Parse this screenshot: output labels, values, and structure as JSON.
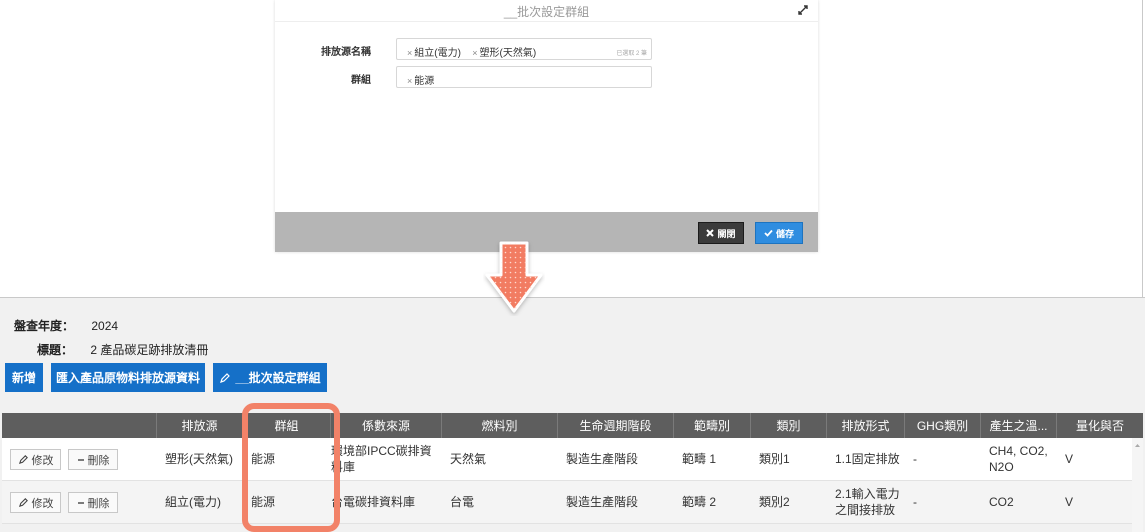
{
  "modal": {
    "title": "__批次設定群組",
    "fields": [
      {
        "label": "排放源名稱",
        "tags": [
          "組立(電力)",
          "塑形(天然氣)"
        ],
        "hint": "已選取 2 筆"
      },
      {
        "label": "群組",
        "tags": [
          "能源"
        ]
      }
    ],
    "tag_remove_glyph": "×",
    "close_label": "關閉",
    "save_label": "儲存"
  },
  "page": {
    "year_label": "盤查年度：",
    "year_value": "2024",
    "title_label": "標題：",
    "title_value": "2 產品碳足跡排放清冊",
    "buttons": {
      "add": "新增",
      "import": "匯入產品原物料排放源資料",
      "batch_group": "__批次設定群組"
    }
  },
  "table": {
    "headers": [
      "",
      "排放源",
      "群組",
      "係數來源",
      "燃料別",
      "生命週期階段",
      "範疇別",
      "類別",
      "排放形式",
      "GHG類別",
      "產生之溫...",
      "量化與否"
    ],
    "edit_label": "修改",
    "delete_label": "刪除",
    "rows": [
      [
        "塑形(天然氣)",
        "能源",
        "環境部IPCC碳排資料庫",
        "天然氣",
        "製造生產階段",
        "範疇 1",
        "類別1",
        "1.1固定排放",
        "-",
        "CH4, CO2, N2O",
        "V"
      ],
      [
        "組立(電力)",
        "能源",
        "台電碳排資料庫",
        "台電",
        "製造生產階段",
        "範疇 2",
        "類別2",
        "2.1輸入電力之間接排放",
        "-",
        "CO2",
        "V"
      ]
    ]
  },
  "colors": {
    "accent": "#1570c8",
    "save": "#2f8de0",
    "header_bg": "#5e5e5e",
    "highlight": "#f28268"
  },
  "icons": [
    "expand-icon",
    "close-icon",
    "check-icon",
    "pencil-icon",
    "minus-icon",
    "down-arrow-icon"
  ]
}
